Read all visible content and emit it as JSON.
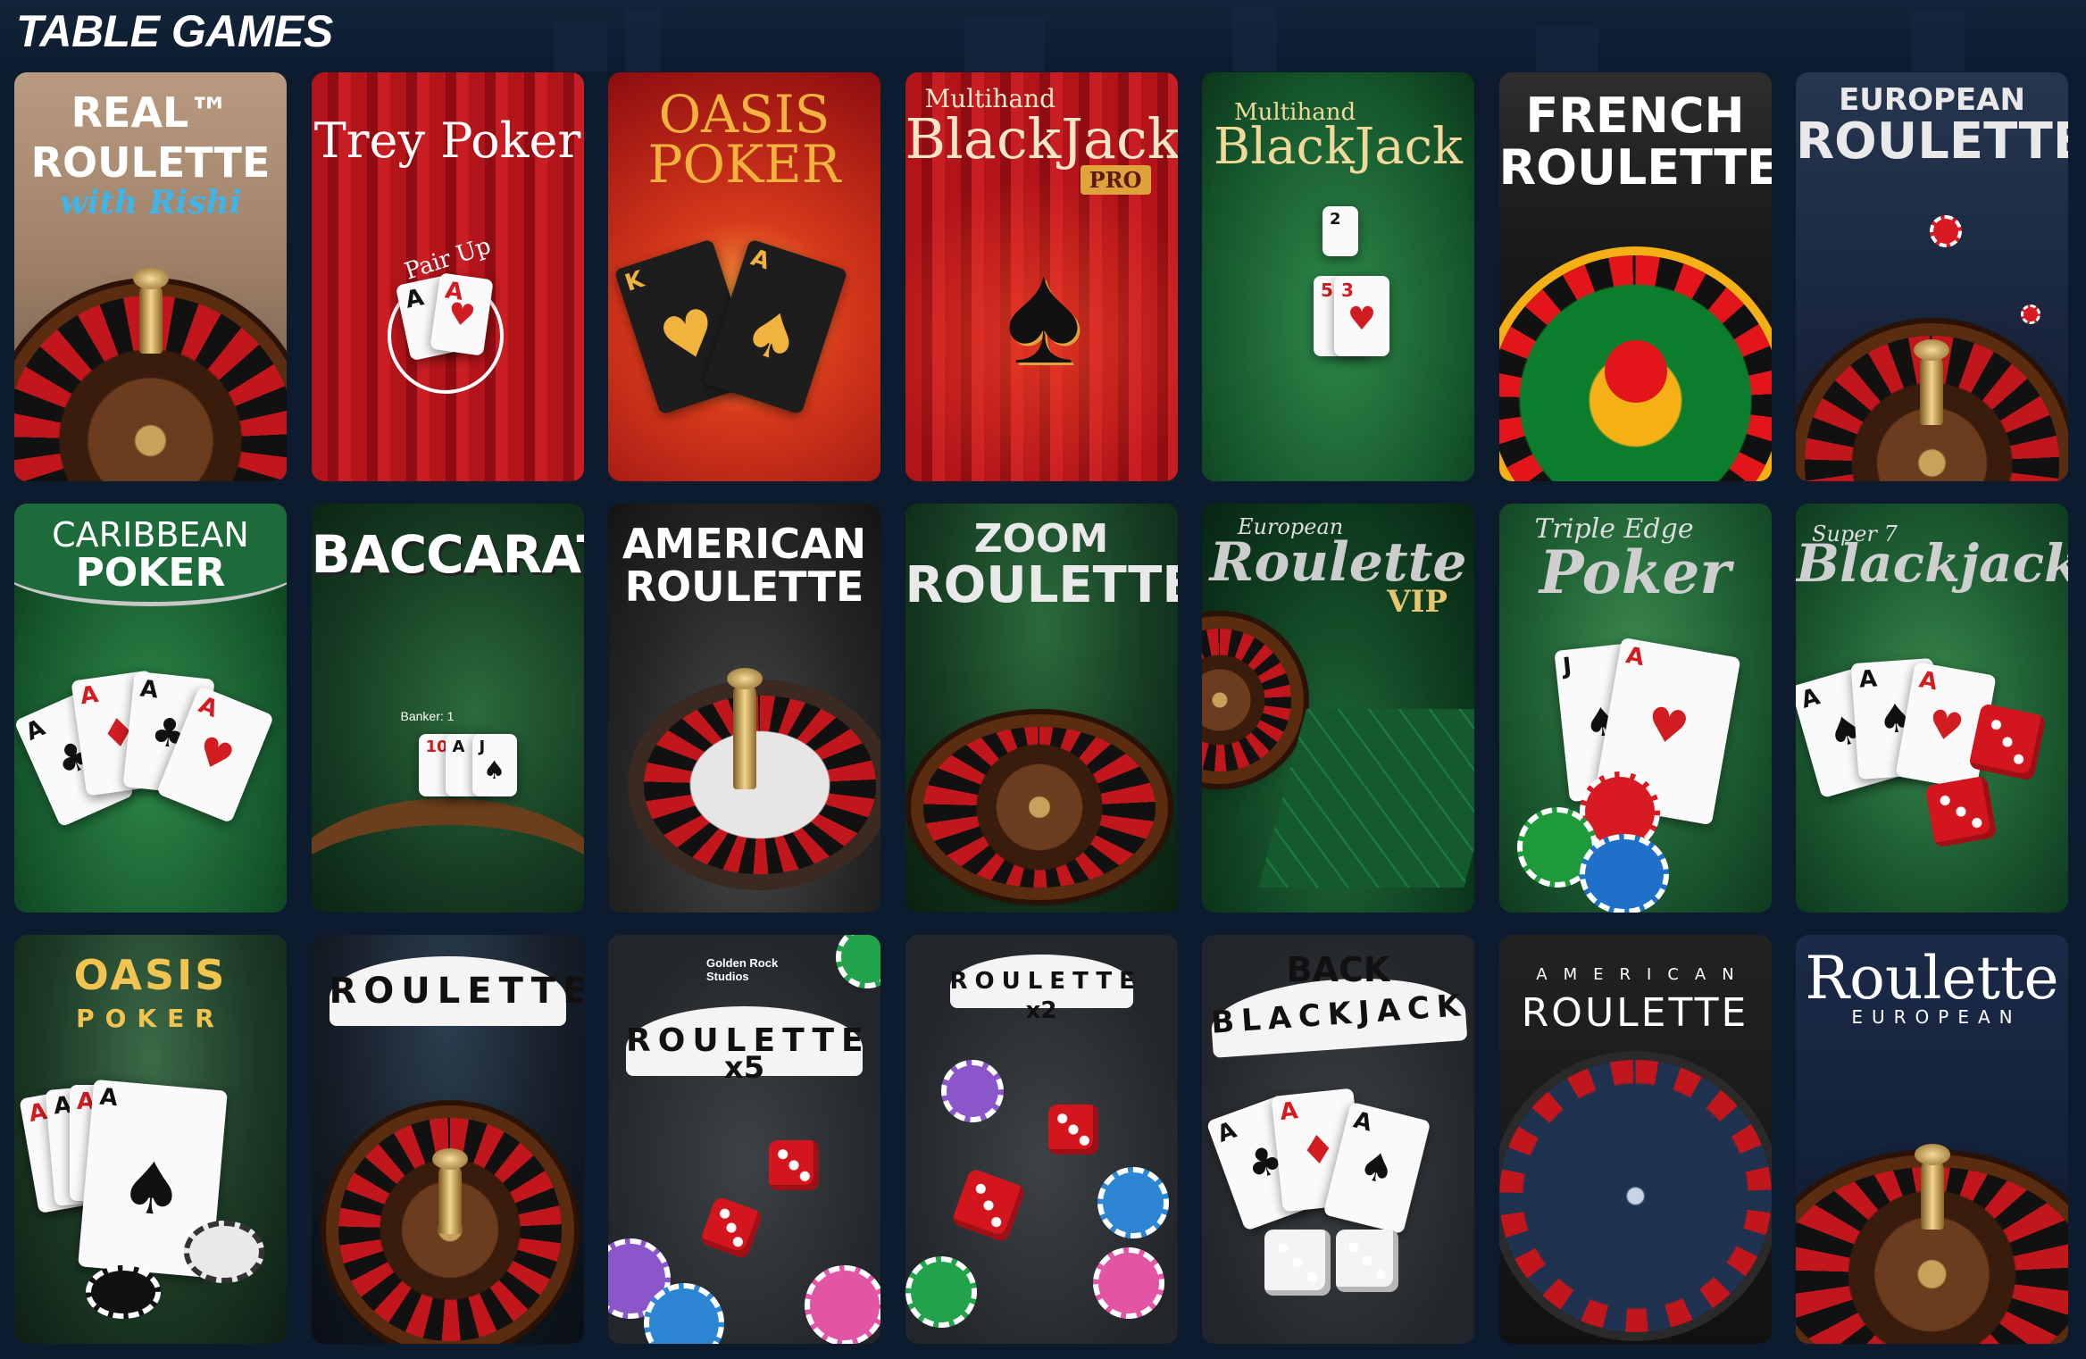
{
  "section": {
    "title": "TABLE GAMES"
  },
  "games": [
    {
      "name": "real-roulette-with-rishi",
      "l1": "REAL™",
      "l2": "ROULETTE",
      "l3": "with Rishi"
    },
    {
      "name": "trey-poker",
      "l1": "Trey Poker",
      "l2": "Pair Up"
    },
    {
      "name": "oasis-poker",
      "l1": "OASIS",
      "l2": "POKER"
    },
    {
      "name": "multihand-blackjack-pro",
      "l1": "Multihand",
      "l2": "BlackJack",
      "l3": "PRO"
    },
    {
      "name": "multihand-blackjack",
      "l1": "Multihand",
      "l2": "BlackJack"
    },
    {
      "name": "french-roulette",
      "l1": "FRENCH",
      "l2": "ROULETTE"
    },
    {
      "name": "european-roulette",
      "l1": "EUROPEAN",
      "l2": "ROULETTE"
    },
    {
      "name": "caribbean-poker",
      "l1": "CARIBBEAN",
      "l2": "POKER"
    },
    {
      "name": "baccarat",
      "l1": "BACCARAT",
      "l2": "Banker: 1"
    },
    {
      "name": "american-roulette",
      "l1": "AMERICAN",
      "l2": "ROULETTE"
    },
    {
      "name": "zoom-roulette",
      "l1": "ZOOM",
      "l2": "ROULETTE"
    },
    {
      "name": "european-roulette-vip",
      "l1": "European",
      "l2": "Roulette",
      "l3": "VIP"
    },
    {
      "name": "triple-edge-poker",
      "l1": "Triple Edge",
      "l2": "Poker"
    },
    {
      "name": "super-7-blackjack",
      "l1": "Super 7",
      "l2": "Blackjack"
    },
    {
      "name": "oasis-poker-2",
      "l1": "OASIS",
      "l2": "POKER"
    },
    {
      "name": "roulette",
      "l1": "ROULETTE"
    },
    {
      "name": "roulette-x5",
      "l1": "ROULETTE",
      "l2": "x5",
      "l3": "Golden Rock Studios"
    },
    {
      "name": "roulette-x2",
      "l1": "ROULETTE",
      "l2": "x2"
    },
    {
      "name": "back-blackjack",
      "l1": "BACK",
      "l2": "BLACKJACK"
    },
    {
      "name": "american-roulette-2",
      "l1": "AMERICAN",
      "l2": "ROULETTE"
    },
    {
      "name": "roulette-european",
      "l1": "Roulette",
      "l2": "EUROPEAN"
    }
  ]
}
